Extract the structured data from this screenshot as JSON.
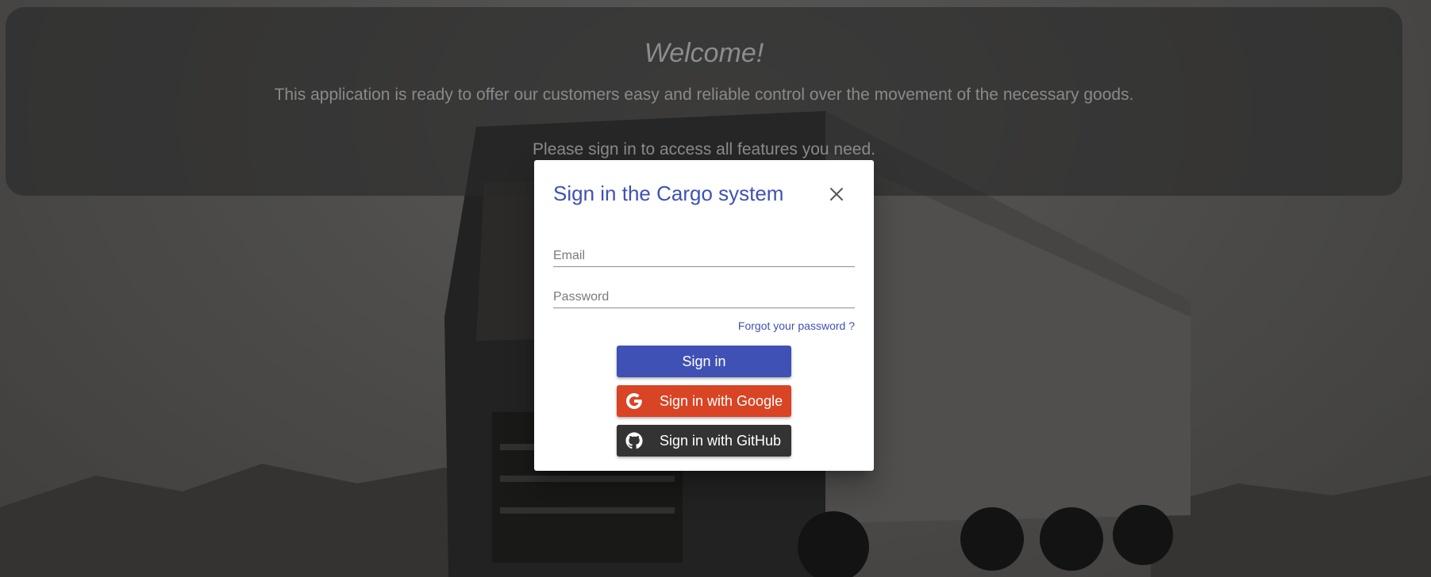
{
  "banner": {
    "title": "Welcome!",
    "line1": "This application is ready to offer our customers easy and reliable control over the movement of the necessary goods.",
    "line2": "Please sign in to access all features you need."
  },
  "dialog": {
    "title": "Sign in the Cargo system",
    "close_icon": "close-icon",
    "email": {
      "placeholder": "Email",
      "value": ""
    },
    "password": {
      "placeholder": "Password",
      "value": ""
    },
    "forgot_link": "Forgot your password ?",
    "signin_label": "Sign in",
    "google_label": "Sign in with Google",
    "github_label": "Sign in with GitHub"
  },
  "colors": {
    "primary": "#3f51b5",
    "google": "#d84424",
    "github": "#333333"
  }
}
